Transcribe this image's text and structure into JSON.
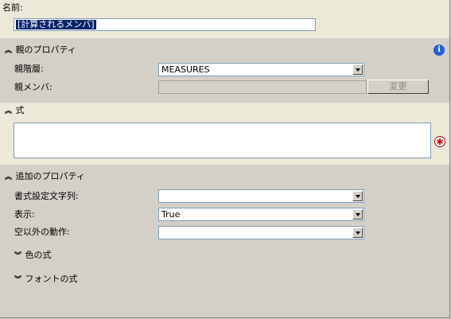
{
  "name": {
    "label": "名前:",
    "value": "[計算されるメンバ]"
  },
  "parent_props": {
    "header": "親のプロパティ",
    "parent_hierarchy_label": "親階層:",
    "parent_hierarchy_value": "MEASURES",
    "parent_member_label": "親メンバ:",
    "parent_member_value": "",
    "change_button": "変更"
  },
  "expression": {
    "header": "式",
    "value": ""
  },
  "additional_props": {
    "header": "追加のプロパティ",
    "format_string_label": "書式設定文字列:",
    "format_string_value": "",
    "visible_label": "表示:",
    "visible_value": "True",
    "non_empty_label": "空以外の動作:",
    "non_empty_value": "",
    "color_expr": "色の式",
    "font_expr": "フォントの式"
  },
  "icons": {
    "collapse": "collapse-chevron-icon",
    "expand": "expand-chevron-icon",
    "info": "info-icon",
    "required": "required-icon"
  },
  "colors": {
    "panel_bg": "#d4d0c8",
    "selection": "#0a246a",
    "info_blue": "#1f5fd8",
    "required_red": "#c00000"
  }
}
